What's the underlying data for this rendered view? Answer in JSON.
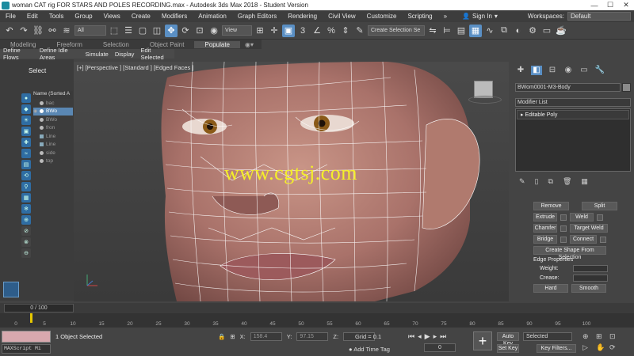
{
  "titlebar": {
    "title": "woman CAT rig FOR STARS AND POLES RECORDING.max - Autodesk 3ds Max 2018 - Student Version",
    "minimize": "—",
    "maximize": "☐",
    "close": "✕"
  },
  "menu": {
    "items": [
      "File",
      "Edit",
      "Tools",
      "Group",
      "Views",
      "Create",
      "Modifiers",
      "Animation",
      "Graph Editors",
      "Rendering",
      "Civil View",
      "Customize",
      "Scripting"
    ],
    "more": "»",
    "signin": "Sign In",
    "workspaces_label": "Workspaces:",
    "workspace_value": "Default"
  },
  "toolbar": {
    "selection_filter": "All",
    "ref_coord": "View",
    "snap_value": "3",
    "named_selection": "Create Selection Se"
  },
  "ribbon": {
    "tabs": [
      "Modeling",
      "Freeform",
      "Selection",
      "Object Paint",
      "Populate"
    ],
    "subtabs": [
      "Define Flows",
      "Define Idle Areas",
      "Simulate",
      "Display",
      "Edit Selected"
    ]
  },
  "scene_explorer": {
    "title": "Select",
    "header": "Name (Sorted A",
    "rows": [
      "bac",
      "BWo",
      "BWo",
      "fron",
      "Line",
      "Line",
      "side",
      "top"
    ]
  },
  "viewport": {
    "label": "[+] [Perspective ] [Standard ] [Edged Faces ]",
    "watermark": "www.cgtsj.com"
  },
  "command_panel": {
    "object_name": "BWom0001-M3-Body",
    "modifier_list": "Modifier List",
    "stack_item": "Editable Poly",
    "buttons": {
      "remove": "Remove",
      "split": "Split",
      "extrude": "Extrude",
      "weld": "Weld",
      "chamfer": "Chamfer",
      "target_weld": "Target Weld",
      "bridge": "Bridge",
      "connect": "Connect",
      "create_shape": "Create Shape From Selection",
      "hard": "Hard",
      "smooth": "Smooth"
    },
    "edge_properties": "Edge Properties",
    "weight_label": "Weight:",
    "crease_label": "Crease:"
  },
  "timeslider": {
    "scrubber": "0 / 100"
  },
  "timeline": {
    "ticks": [
      "0",
      "5",
      "10",
      "15",
      "20",
      "25",
      "30",
      "35",
      "40",
      "45",
      "50",
      "55",
      "60",
      "65",
      "70",
      "75",
      "80",
      "85",
      "90",
      "95",
      "100"
    ]
  },
  "status": {
    "maxscript": "MAXScript Mi",
    "selected": "1 Object Selected",
    "x_label": "X:",
    "x_value": "158.4",
    "y_label": "Y:",
    "y_value": "97.15",
    "z_label": "Z:",
    "grid": "Grid = 0.1",
    "add_time_tag": "Add Time Tag",
    "frame": "0",
    "auto_key": "Auto Key",
    "set_key": "Set Key",
    "selected_dropdown": "Selected",
    "key_filters": "Key Filters..."
  }
}
